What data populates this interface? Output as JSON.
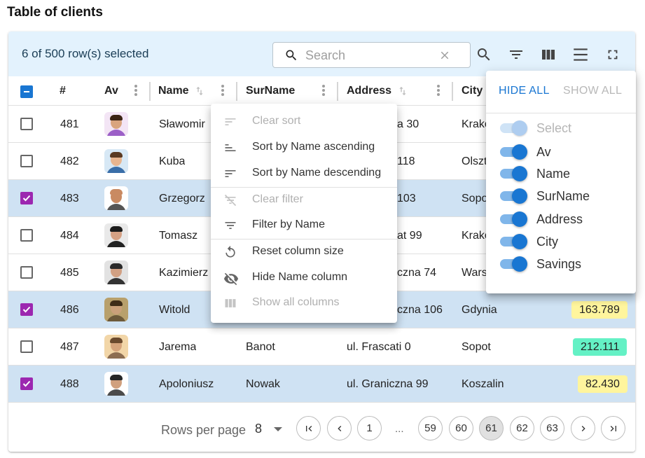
{
  "page": {
    "title": "Table of clients"
  },
  "toolbar": {
    "selected_text": "6 of 500 row(s) selected",
    "search_placeholder": "Search",
    "icons": [
      "search-icon",
      "filter-icon",
      "columns-icon",
      "density-icon",
      "fullscreen-icon"
    ]
  },
  "columns": {
    "num": "#",
    "av": "Av",
    "name": "Name",
    "surname": "SurName",
    "address": "Address",
    "city": "City"
  },
  "rows": [
    {
      "num": "481",
      "name": "Sławomir",
      "surname": "",
      "address": "a 30",
      "city": "Krakó",
      "savings": "",
      "selected": false
    },
    {
      "num": "482",
      "name": "Kuba",
      "surname": "",
      "address": "118",
      "city": "Olszt",
      "savings": "",
      "selected": false
    },
    {
      "num": "483",
      "name": "Grzegorz",
      "surname": "",
      "address": "103",
      "city": "Sopo",
      "savings": "",
      "selected": true
    },
    {
      "num": "484",
      "name": "Tomasz",
      "surname": "",
      "address": "at 99",
      "city": "Krakó",
      "savings": "",
      "selected": false
    },
    {
      "num": "485",
      "name": "Kazimierz",
      "surname": "",
      "address": "czna 74",
      "city": "Wars",
      "savings": "",
      "selected": false
    },
    {
      "num": "486",
      "name": "Witold",
      "surname": "",
      "address": "czna 106",
      "city": "Gdynia",
      "savings": "163.789",
      "savings_color": "#fff59d",
      "selected": true
    },
    {
      "num": "487",
      "name": "Jarema",
      "surname": "Banot",
      "address": "ul. Frascati 0",
      "city": "Sopot",
      "savings": "212.111",
      "savings_color": "#64f1c5",
      "selected": false
    },
    {
      "num": "488",
      "name": "Apoloniusz",
      "surname": "Nowak",
      "address": "ul. Graniczna 99",
      "city": "Koszalin",
      "savings": "82.430",
      "savings_color": "#fff59d",
      "selected": true
    }
  ],
  "column_menu": {
    "items": [
      {
        "label": "Clear sort",
        "icon": "clear-sort-icon",
        "disabled": true
      },
      {
        "label": "Sort by Name ascending",
        "icon": "sort-ascending-icon",
        "disabled": false
      },
      {
        "label": "Sort by Name descending",
        "icon": "sort-descending-icon",
        "disabled": false
      },
      {
        "label": "Clear filter",
        "icon": "clear-filter-icon",
        "disabled": true
      },
      {
        "label": "Filter by Name",
        "icon": "filter-icon",
        "disabled": false
      },
      {
        "label": "Reset column size",
        "icon": "reset-icon",
        "disabled": false
      },
      {
        "label": "Hide Name column",
        "icon": "eye-off-icon",
        "disabled": false
      },
      {
        "label": "Show all columns",
        "icon": "view-column-icon",
        "disabled": true
      }
    ]
  },
  "column_panel": {
    "hide_all": "HIDE ALL",
    "show_all": "SHOW ALL",
    "toggles": [
      {
        "label": "Select",
        "on": true,
        "disabled": true
      },
      {
        "label": "Av",
        "on": true,
        "disabled": false
      },
      {
        "label": "Name",
        "on": true,
        "disabled": false
      },
      {
        "label": "SurName",
        "on": true,
        "disabled": false
      },
      {
        "label": "Address",
        "on": true,
        "disabled": false
      },
      {
        "label": "City",
        "on": true,
        "disabled": false
      },
      {
        "label": "Savings",
        "on": true,
        "disabled": false
      }
    ]
  },
  "footer": {
    "rows_per_page_label": "Rows per page",
    "rows_per_page_value": "8",
    "pages": [
      "1",
      "59",
      "60",
      "61",
      "62",
      "63"
    ],
    "ellipsis": "...",
    "current_page": "61"
  },
  "colors": {
    "toolbar_bg": "#e3f2fd",
    "selected_row_bg": "#cfe2f3",
    "checkbox_checked": "#9c27b0",
    "primary": "#1976d2"
  }
}
